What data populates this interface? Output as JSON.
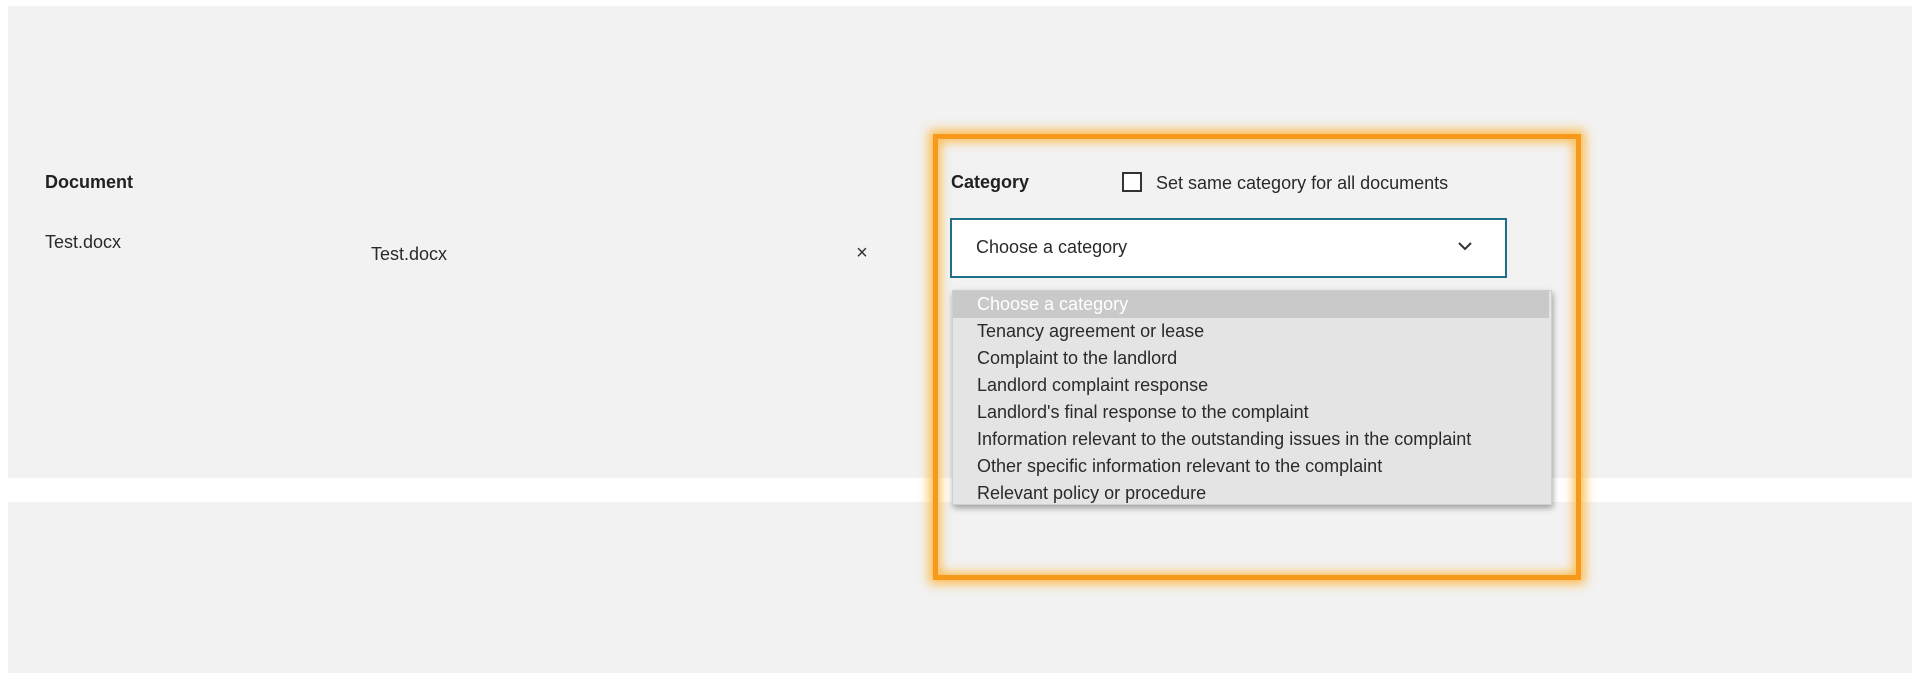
{
  "documents": {
    "header": "Document",
    "file_label": "Test.docx",
    "file_name": "Test.docx",
    "remove_label": "×"
  },
  "category": {
    "label": "Category",
    "same_for_all_label": "Set same category for all documents",
    "same_for_all_checked": false,
    "select": {
      "value": "Choose a category",
      "options": [
        "Choose a category",
        "Tenancy agreement or lease",
        "Complaint to the landlord",
        "Landlord complaint response",
        "Landlord's final response to the complaint",
        "Information relevant to the outstanding issues in the complaint",
        "Other specific information relevant to the complaint",
        "Relevant policy or procedure"
      ],
      "highlighted_index": 0
    }
  },
  "icons": {
    "chevron": "chevron-down-icon",
    "remove": "close-icon"
  },
  "colors": {
    "panel_background": "#f2f2f2",
    "select_border": "#1d6f8a",
    "highlight_frame": "#f79a1c",
    "dropdown_background": "#e4e4e4",
    "dropdown_selected": "#c9c9c9"
  }
}
